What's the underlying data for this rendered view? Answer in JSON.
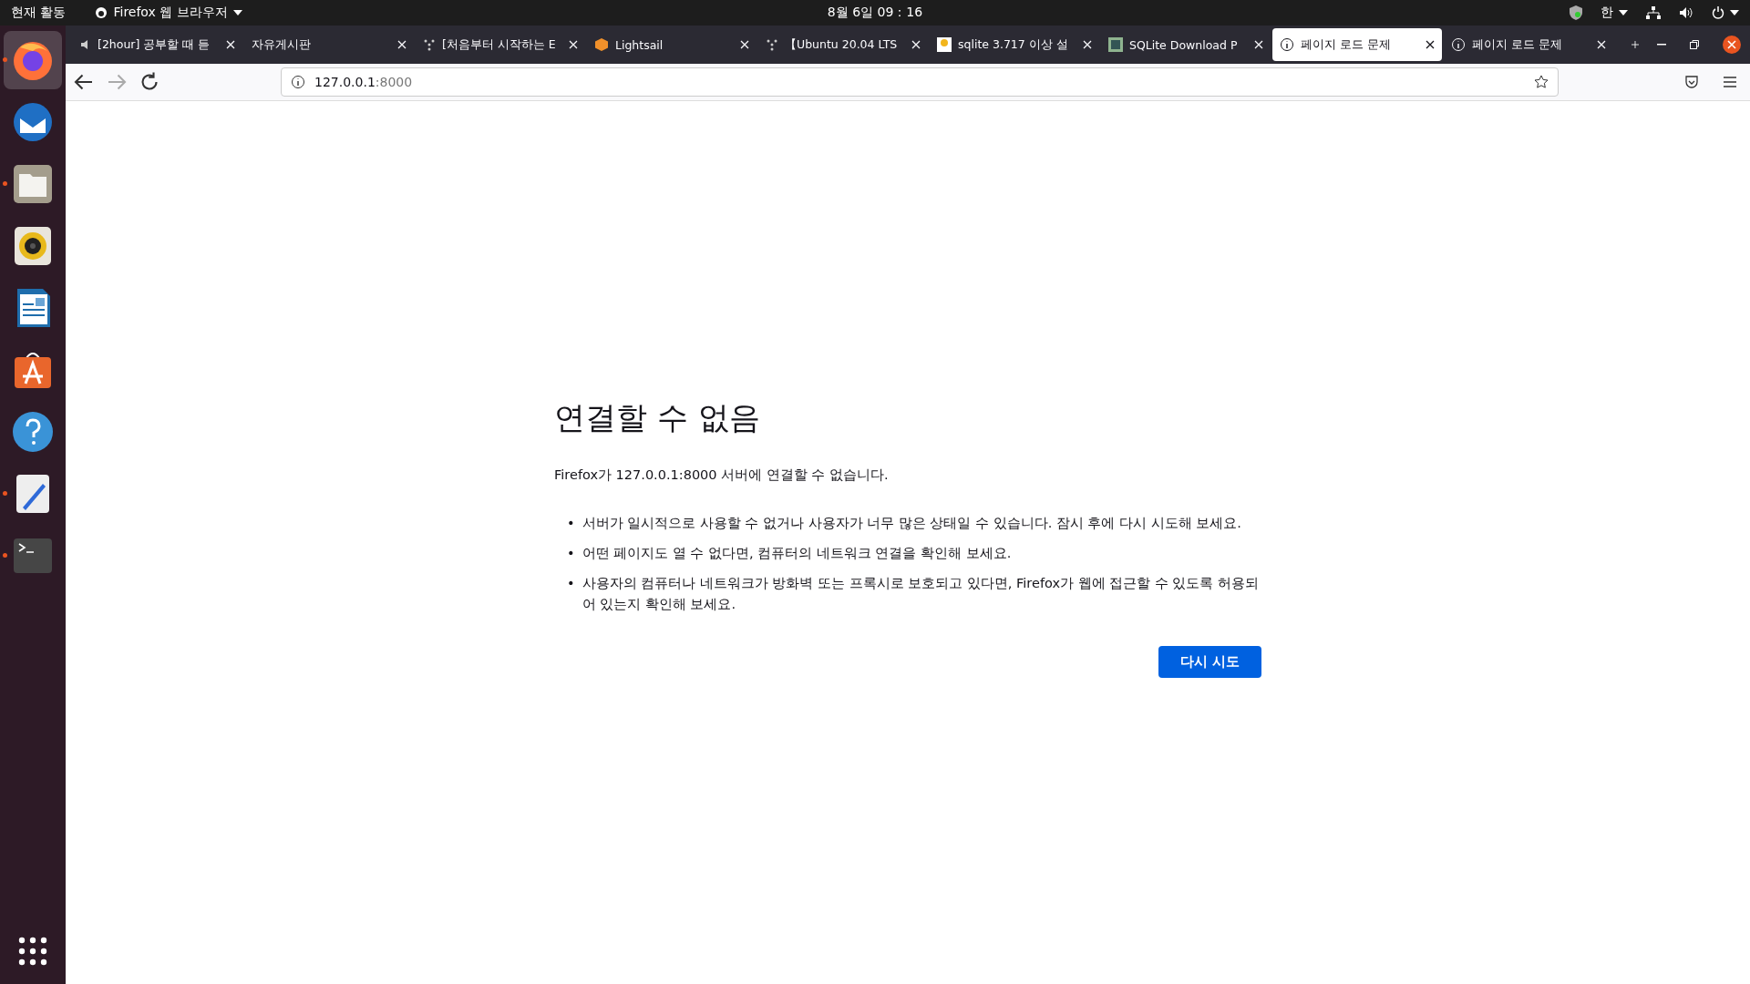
{
  "top_bar": {
    "activities": "현재 활동",
    "app_menu": "Firefox 웹 브라우저",
    "clock": "8월 6일  09：16",
    "input_method": "한"
  },
  "dock": [
    {
      "kind": "firefox",
      "running": true,
      "selected": true
    },
    {
      "kind": "mail",
      "running": false,
      "selected": false
    },
    {
      "kind": "files",
      "running": true,
      "selected": false
    },
    {
      "kind": "music",
      "running": false,
      "selected": false
    },
    {
      "kind": "writer",
      "running": false,
      "selected": false
    },
    {
      "kind": "store",
      "running": false,
      "selected": false
    },
    {
      "kind": "help",
      "running": false,
      "selected": false
    },
    {
      "kind": "editor",
      "running": true,
      "selected": false
    },
    {
      "kind": "terminal",
      "running": true,
      "selected": false
    }
  ],
  "tabs": [
    {
      "label": "[2hour] 공부할 때 듣",
      "kind": "audio",
      "selected": false
    },
    {
      "label": "자유게시판",
      "kind": "plain",
      "selected": false
    },
    {
      "label": "[처음부터 시작하는 E",
      "kind": "dots",
      "selected": false
    },
    {
      "label": "Lightsail",
      "kind": "cube",
      "selected": false
    },
    {
      "label": "【Ubuntu 20.04 LTS",
      "kind": "dots",
      "selected": false
    },
    {
      "label": "sqlite 3.717 이상 설",
      "kind": "image",
      "selected": false
    },
    {
      "label": "SQLite Download P",
      "kind": "database",
      "selected": false
    },
    {
      "label": "페이지 로드 문제",
      "kind": "info",
      "selected": true
    },
    {
      "label": "페이지 로드 문제",
      "kind": "info",
      "selected": false
    }
  ],
  "address_bar": {
    "host": "127.0.0.1",
    "port": ":8000"
  },
  "error_page": {
    "title": "연결할 수 없음",
    "message": "Firefox가 127.0.0.1:8000 서버에 연결할 수 없습니다.",
    "bullets": [
      {
        "marker": "•",
        "text": "서버가 일시적으로 사용할 수 없거나 사용자가 너무 많은 상태일 수 있습니다. 잠시 후에 다시 시도해 보세요."
      },
      {
        "marker": "•",
        "text": "어떤 페이지도 열 수 없다면, 컴퓨터의 네트워크 연결을 확인해 보세요."
      },
      {
        "marker": "•",
        "text": "사용자의 컴퓨터나 네트워크가 방화벽 또는 프록시로 보호되고 있다면, Firefox가 웹에 접근할 수 있도록 허용되어 있는지 확인해 보세요."
      }
    ],
    "retry_button": "다시 시도"
  }
}
